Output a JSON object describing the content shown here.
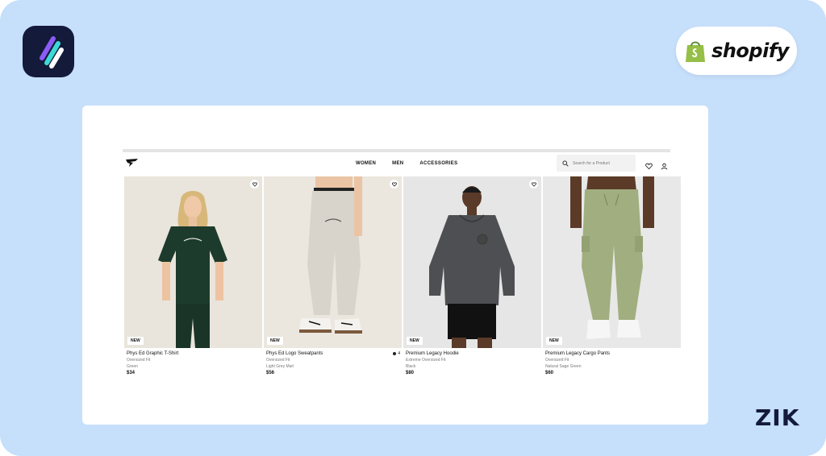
{
  "branding": {
    "app_logo_icon": "app-logo-icon",
    "shopify_wordmark": "shopify",
    "shopify_bag_icon": "shopify-bag-icon",
    "corner_watermark": "ZIK"
  },
  "colors": {
    "background": "#c6dffb",
    "app_logo_bg": "#141a3a",
    "shopify_green": "#95bf47"
  },
  "store": {
    "logo_icon": "gymshark-logo-icon",
    "nav": [
      "WOMEN",
      "MEN",
      "ACCESSORIES"
    ],
    "search_placeholder": "Search for a Product",
    "wishlist_icon": "heart-icon",
    "account_icon": "user-icon"
  },
  "products": [
    {
      "name": "Phys Ed Graphic T-Shirt",
      "fit": "Oversized Fit",
      "color": "Green",
      "price": "$34",
      "badge": "NEW",
      "wishlist": true,
      "swatch_count": ""
    },
    {
      "name": "Phys Ed Logo Sweatpants",
      "fit": "Oversized Fit",
      "color": "Light Grey Marl",
      "price": "$56",
      "badge": "NEW",
      "wishlist": true,
      "swatch_count": "4"
    },
    {
      "name": "Premium Legacy Hoodie",
      "fit": "Extreme Oversized Fit",
      "color": "Black",
      "price": "$80",
      "badge": "NEW",
      "wishlist": true,
      "swatch_count": ""
    },
    {
      "name": "Premium Legacy Cargo Pants",
      "fit": "Oversized Fit",
      "color": "Natural Sage Green",
      "price": "$60",
      "badge": "NEW",
      "wishlist": false,
      "swatch_count": ""
    }
  ]
}
